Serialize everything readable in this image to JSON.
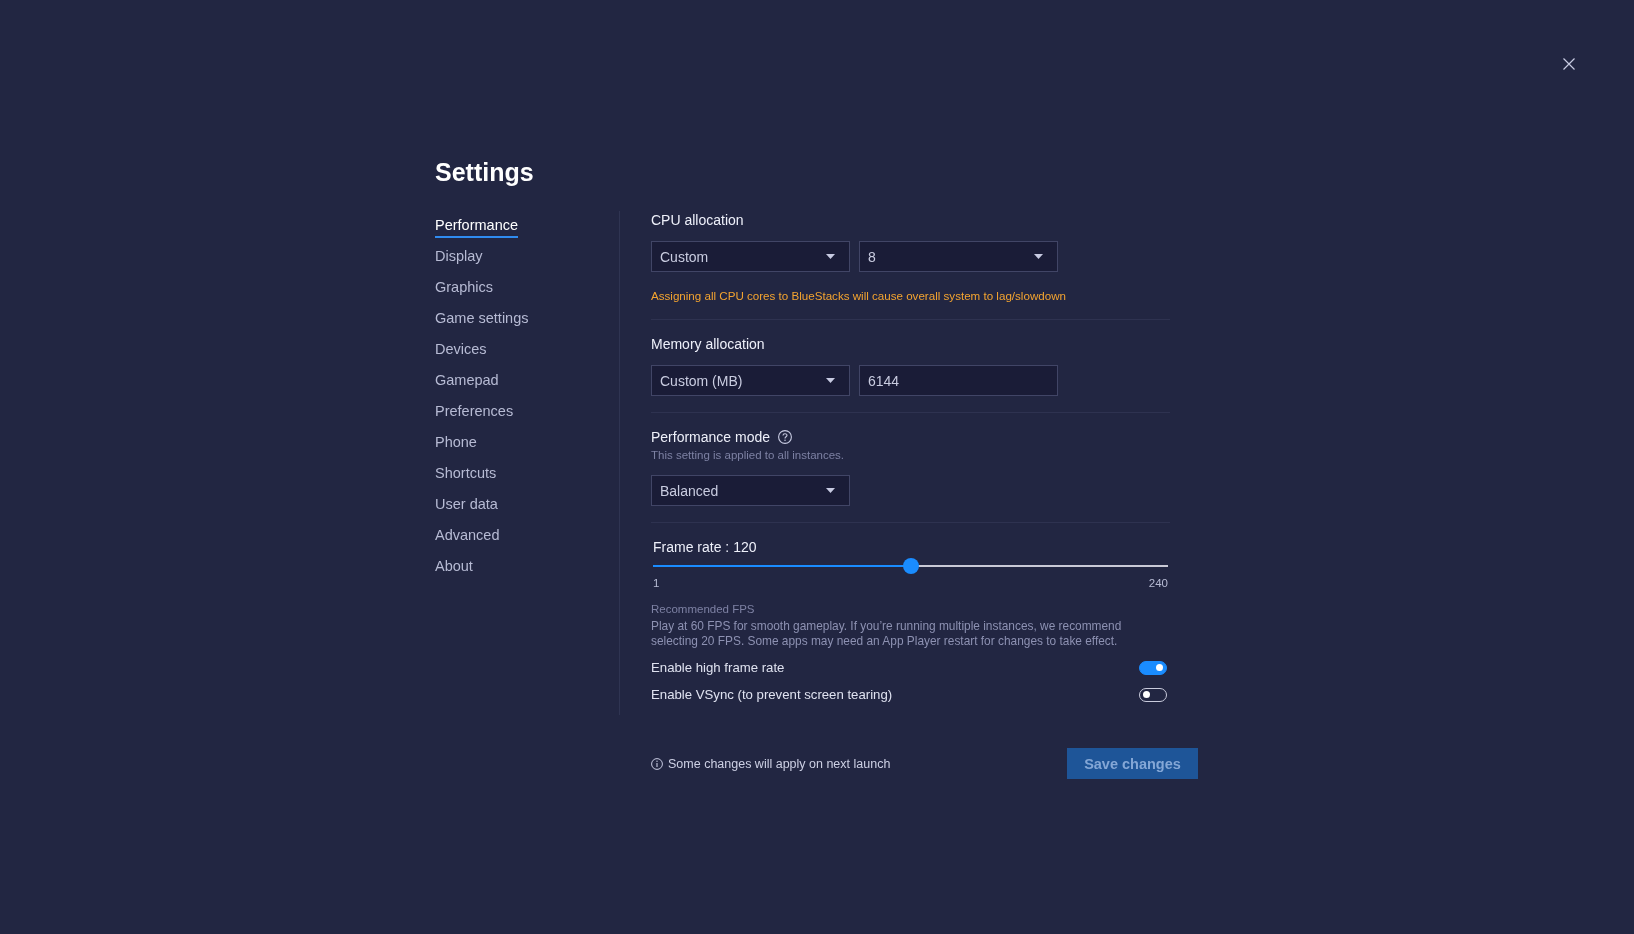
{
  "window": {
    "title": "Settings"
  },
  "sidebar": {
    "items": [
      {
        "label": "Performance",
        "selected": true
      },
      {
        "label": "Display",
        "selected": false
      },
      {
        "label": "Graphics",
        "selected": false
      },
      {
        "label": "Game settings",
        "selected": false
      },
      {
        "label": "Devices",
        "selected": false
      },
      {
        "label": "Gamepad",
        "selected": false
      },
      {
        "label": "Preferences",
        "selected": false
      },
      {
        "label": "Phone",
        "selected": false
      },
      {
        "label": "Shortcuts",
        "selected": false
      },
      {
        "label": "User data",
        "selected": false
      },
      {
        "label": "Advanced",
        "selected": false
      },
      {
        "label": "About",
        "selected": false
      }
    ]
  },
  "cpu_allocation": {
    "label": "CPU allocation",
    "mode": {
      "value": "Custom"
    },
    "cores": {
      "value": "8"
    },
    "warning": "Assigning all CPU cores to BlueStacks will cause overall system to lag/slowdown"
  },
  "memory_allocation": {
    "label": "Memory allocation",
    "mode": {
      "value": "Custom (MB)"
    },
    "amount": {
      "value": "6144"
    }
  },
  "performance_mode": {
    "label": "Performance mode",
    "note": "This setting is applied to all instances.",
    "mode": {
      "value": "Balanced"
    }
  },
  "frame_rate": {
    "label": "Frame rate : 120",
    "level": 0.5,
    "min_label": "1",
    "max_label": "240",
    "recommendation_title": "Recommended FPS",
    "recommendation": "Play at 60 FPS for smooth gameplay. If you’re running multiple instances, we recommend selecting 20 FPS. Some apps may need an App Player restart for changes to take effect."
  },
  "toggles": [
    {
      "label": "Enable high frame rate",
      "on": true
    },
    {
      "label": "Enable VSync (to prevent screen tearing)",
      "on": false
    }
  ],
  "footer": {
    "note": "Some changes will apply on next launch",
    "save_button": {
      "label": "Save changes",
      "disabled": true
    }
  }
}
